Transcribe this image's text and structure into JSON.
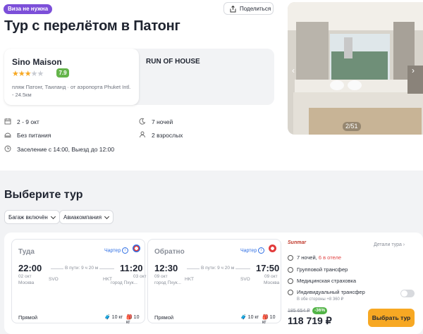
{
  "badge": "Виза не нужна",
  "share_label": "Поделиться",
  "title": "Тур с перелётом в Патонг",
  "hotel": {
    "name": "Sino Maison",
    "rating": "7.9",
    "stars": 3,
    "address": "пляж Патонг, Таиланд · от аэропорта Phuket Intl. - 24.5км",
    "room": "RUN OF HOUSE"
  },
  "info": {
    "dates": "2 - 9 окт",
    "nights": "7 ночей",
    "meal": "Без питания",
    "guests": "2 взрослых",
    "checkin": "Заселение с 14:00, Выезд до 12:00"
  },
  "photo_counter": "2/51",
  "section_title": "Выберите тур",
  "filters": [
    "Багаж включён",
    "Авиакомпания"
  ],
  "outbound": {
    "label": "Туда",
    "charter": "Чартер",
    "dep_time": "22:00",
    "dep_date": "02 окт",
    "dep_city": "Москва",
    "dep_code": "SVO",
    "duration": "В пути: 9 ч 20 м",
    "arr_code": "HKT",
    "arr_time": "11:20",
    "arr_date": "03 окт",
    "arr_city": "город Пхук...",
    "type": "Прямой",
    "bag1": "10 кг",
    "bag2": "10 кг"
  },
  "return": {
    "label": "Обратно",
    "charter": "Чартер",
    "dep_time": "12:30",
    "dep_date": "09 окт",
    "dep_city": "город Пхук...",
    "dep_code": "HKT",
    "duration": "В пути: 9 ч 20 м",
    "arr_code": "SVO",
    "arr_time": "17:50",
    "arr_date": "09 окт",
    "arr_city": "Москва",
    "type": "Прямой",
    "bag1": "10 кг",
    "bag2": "10 кг"
  },
  "offer": {
    "operator": "Sunmar",
    "details": "Детали тура",
    "nights": "7 ночей,",
    "hotel_note": "6 в отеле",
    "transfer": "Групповой трансфер",
    "insurance": "Медицинская страховка",
    "individual": "Индивидуальный трансфер",
    "individual_note": "В обе стороны +8 360 ₽",
    "old_price": "185 654 ₽",
    "discount": "-36%",
    "price": "118 719 ₽",
    "buy": "Выбрать тур"
  },
  "colors": {
    "accent": "#f7a823",
    "badge": "#7c4fd9",
    "rating": "#64b44a",
    "link": "#2f6fe4"
  }
}
